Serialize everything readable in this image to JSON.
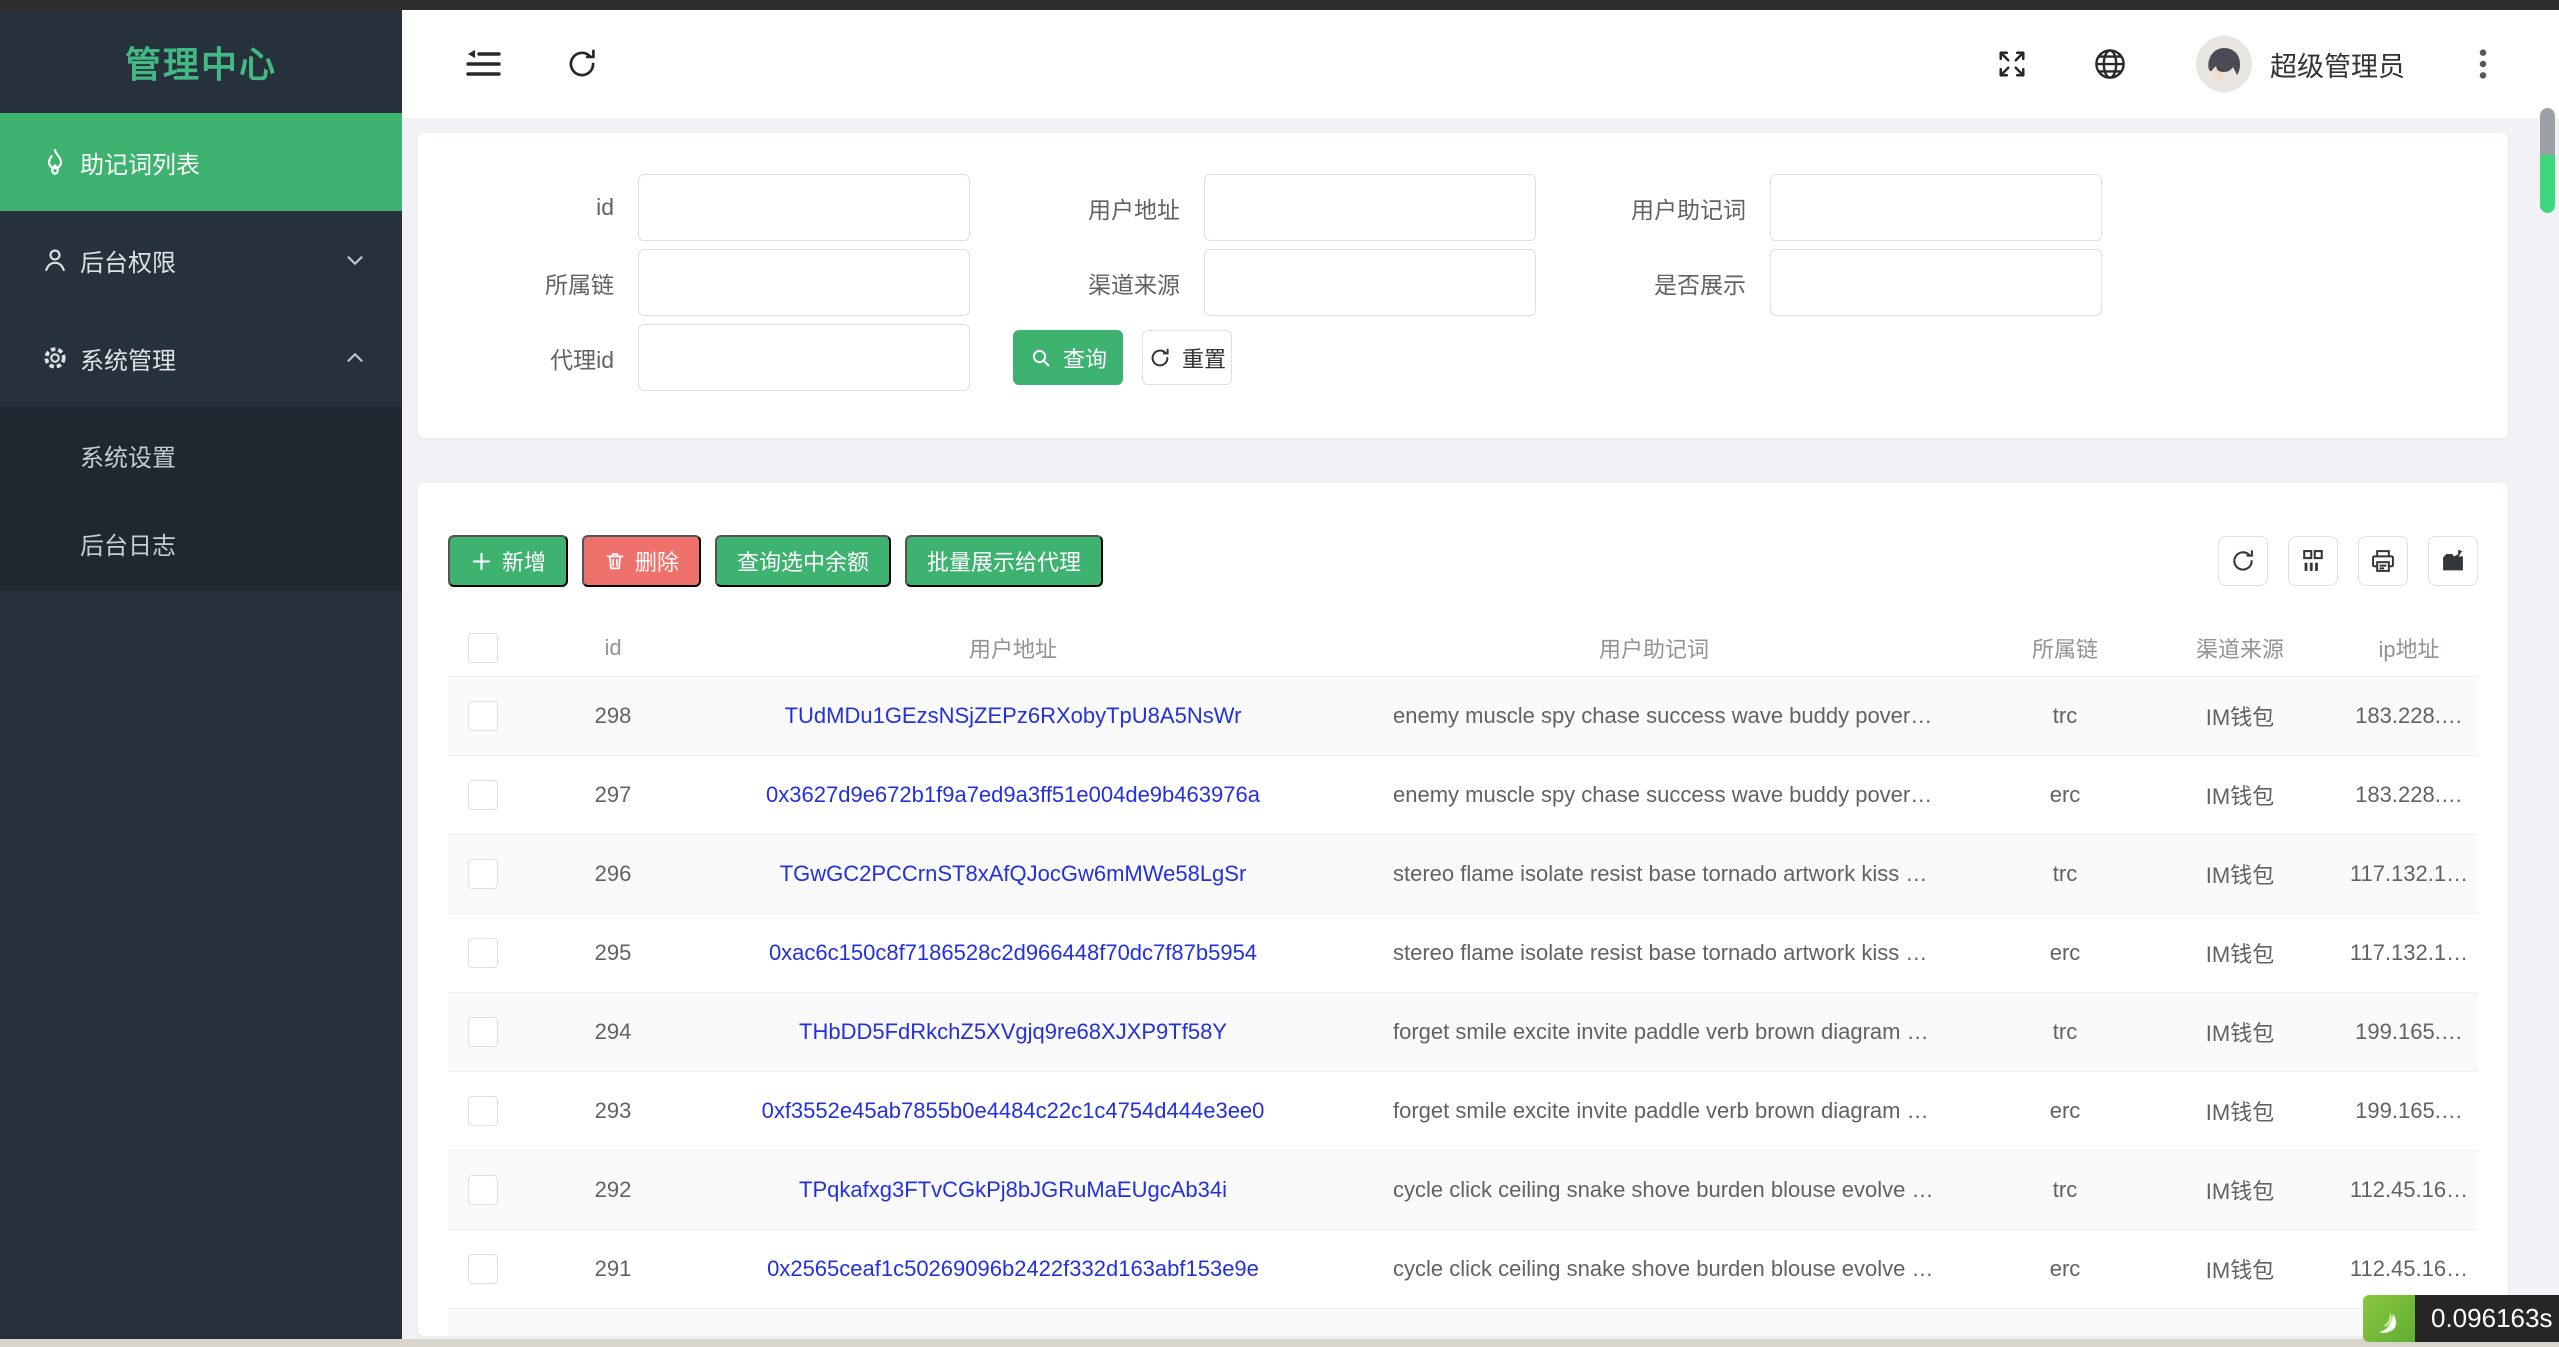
{
  "app": {
    "title": "管理中心"
  },
  "header": {
    "username": "超级管理员"
  },
  "sidebar": {
    "items": [
      {
        "label": "助记词列表",
        "icon": "flame-icon",
        "active": true
      },
      {
        "label": "后台权限",
        "icon": "user-icon",
        "state": "collapsed"
      },
      {
        "label": "系统管理",
        "icon": "gear-icon",
        "state": "expanded"
      }
    ],
    "submenu": [
      {
        "label": "系统设置"
      },
      {
        "label": "后台日志"
      }
    ]
  },
  "search_form": {
    "fields": [
      {
        "label": "id",
        "value": "",
        "placeholder": ""
      },
      {
        "label": "用户地址",
        "value": "",
        "placeholder": ""
      },
      {
        "label": "用户助记词",
        "value": "",
        "placeholder": ""
      },
      {
        "label": "所属链",
        "value": "",
        "placeholder": ""
      },
      {
        "label": "渠道来源",
        "value": "",
        "placeholder": ""
      },
      {
        "label": "是否展示",
        "value": "",
        "placeholder": ""
      },
      {
        "label": "代理id",
        "value": "",
        "placeholder": ""
      }
    ],
    "query_label": "查询",
    "reset_label": "重置"
  },
  "toolbar": {
    "add_label": "新增",
    "delete_label": "删除",
    "query_balance_label": "查询选中余额",
    "batch_show_label": "批量展示给代理",
    "icon_buttons": [
      "refresh-icon",
      "columns-icon",
      "printer-icon",
      "export-icon"
    ]
  },
  "table": {
    "columns": [
      "id",
      "用户地址",
      "用户助记词",
      "所属链",
      "渠道来源",
      "ip地址"
    ],
    "rows": [
      {
        "id": "298",
        "address": "TUdMDu1GEzsNSjZEPz6RXobyTpU8A5NsWr",
        "mnemonic": "enemy muscle spy chase success wave buddy pover…",
        "chain": "trc",
        "channel": "IM钱包",
        "ip": "183.228.…"
      },
      {
        "id": "297",
        "address": "0x3627d9e672b1f9a7ed9a3ff51e004de9b463976a",
        "mnemonic": "enemy muscle spy chase success wave buddy pover…",
        "chain": "erc",
        "channel": "IM钱包",
        "ip": "183.228.…"
      },
      {
        "id": "296",
        "address": "TGwGC2PCCrnST8xAfQJocGw6mMWe58LgSr",
        "mnemonic": "stereo flame isolate resist base tornado artwork kiss …",
        "chain": "trc",
        "channel": "IM钱包",
        "ip": "117.132.1…"
      },
      {
        "id": "295",
        "address": "0xac6c150c8f7186528c2d966448f70dc7f87b5954",
        "mnemonic": "stereo flame isolate resist base tornado artwork kiss …",
        "chain": "erc",
        "channel": "IM钱包",
        "ip": "117.132.1…"
      },
      {
        "id": "294",
        "address": "THbDD5FdRkchZ5XVgjq9re68XJXP9Tf58Y",
        "mnemonic": "forget smile excite invite paddle verb brown diagram …",
        "chain": "trc",
        "channel": "IM钱包",
        "ip": "199.165.…"
      },
      {
        "id": "293",
        "address": "0xf3552e45ab7855b0e4484c22c1c4754d444e3ee0",
        "mnemonic": "forget smile excite invite paddle verb brown diagram …",
        "chain": "erc",
        "channel": "IM钱包",
        "ip": "199.165.…"
      },
      {
        "id": "292",
        "address": "TPqkafxg3FTvCGkPj8bJGRuMaEUgcAb34i",
        "mnemonic": "cycle click ceiling snake shove burden blouse evolve …",
        "chain": "trc",
        "channel": "IM钱包",
        "ip": "112.45.16…"
      },
      {
        "id": "291",
        "address": "0x2565ceaf1c50269096b2422f332d163abf153e9e",
        "mnemonic": "cycle click ceiling snake shove burden blouse evolve …",
        "chain": "erc",
        "channel": "IM钱包",
        "ip": "112.45.16…"
      }
    ]
  },
  "debug": {
    "time": "0.096163s"
  },
  "colors": {
    "accent_green": "#3eb370",
    "title_green": "#42b983",
    "danger_red": "#ef716c",
    "link_blue": "#2230dd",
    "sidebar_bg": "#27313b"
  }
}
